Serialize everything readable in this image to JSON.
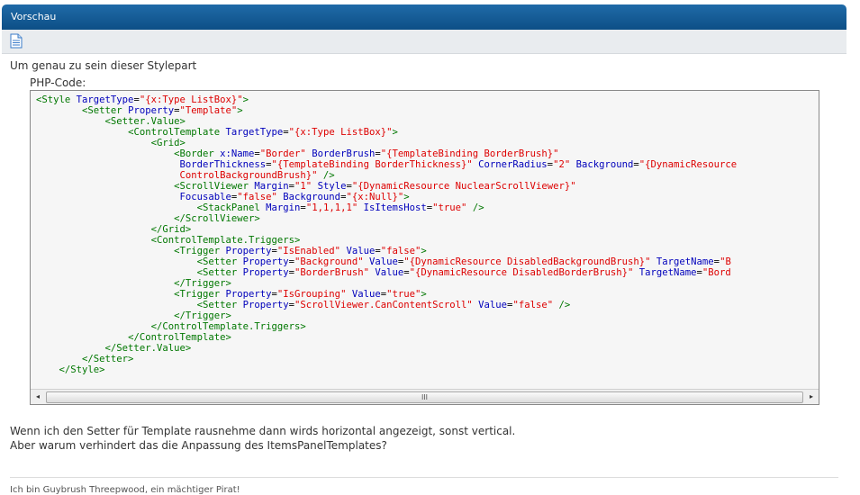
{
  "header": {
    "title": "Vorschau"
  },
  "toolbar": {
    "icon": "document-icon"
  },
  "post": {
    "intro": "Um genau zu sein dieser Stylepart",
    "code_label": "PHP-Code:",
    "code_lines": [
      [
        [
          "t",
          "<Style "
        ],
        [
          "a",
          "TargetType"
        ],
        [
          "p",
          "="
        ],
        [
          "s",
          "\"{x:Type ListBox}\""
        ],
        [
          "t",
          ">"
        ]
      ],
      [
        [
          "p",
          "        "
        ],
        [
          "t",
          "<Setter "
        ],
        [
          "a",
          "Property"
        ],
        [
          "p",
          "="
        ],
        [
          "s",
          "\"Template\""
        ],
        [
          "t",
          ">"
        ]
      ],
      [
        [
          "p",
          "            "
        ],
        [
          "t",
          "<Setter.Value>"
        ]
      ],
      [
        [
          "p",
          "                "
        ],
        [
          "t",
          "<ControlTemplate "
        ],
        [
          "a",
          "TargetType"
        ],
        [
          "p",
          "="
        ],
        [
          "s",
          "\"{x:Type ListBox}\""
        ],
        [
          "t",
          ">"
        ]
      ],
      [
        [
          "p",
          "                    "
        ],
        [
          "t",
          "<Grid>"
        ]
      ],
      [
        [
          "p",
          "                        "
        ],
        [
          "t",
          "<Border "
        ],
        [
          "a",
          "x:Name"
        ],
        [
          "p",
          "="
        ],
        [
          "s",
          "\"Border\" "
        ],
        [
          "a",
          "BorderBrush"
        ],
        [
          "p",
          "="
        ],
        [
          "s",
          "\"{TemplateBinding BorderBrush}\""
        ]
      ],
      [
        [
          "p",
          "                         "
        ],
        [
          "a",
          "BorderThickness"
        ],
        [
          "p",
          "="
        ],
        [
          "s",
          "\"{TemplateBinding BorderThickness}\" "
        ],
        [
          "a",
          "CornerRadius"
        ],
        [
          "p",
          "="
        ],
        [
          "s",
          "\"2\" "
        ],
        [
          "a",
          "Background"
        ],
        [
          "p",
          "="
        ],
        [
          "s",
          "\"{DynamicResource"
        ]
      ],
      [
        [
          "p",
          "                         "
        ],
        [
          "s",
          "ControlBackgroundBrush}\" "
        ],
        [
          "t",
          "/>"
        ]
      ],
      [
        [
          "p",
          "                        "
        ],
        [
          "t",
          "<ScrollViewer "
        ],
        [
          "a",
          "Margin"
        ],
        [
          "p",
          "="
        ],
        [
          "s",
          "\"1\" "
        ],
        [
          "a",
          "Style"
        ],
        [
          "p",
          "="
        ],
        [
          "s",
          "\"{DynamicResource NuclearScrollViewer}\""
        ]
      ],
      [
        [
          "p",
          "                         "
        ],
        [
          "a",
          "Focusable"
        ],
        [
          "p",
          "="
        ],
        [
          "s",
          "\"false\" "
        ],
        [
          "a",
          "Background"
        ],
        [
          "p",
          "="
        ],
        [
          "s",
          "\"{x:Null}\""
        ],
        [
          "t",
          ">"
        ]
      ],
      [
        [
          "p",
          "                            "
        ],
        [
          "t",
          "<StackPanel "
        ],
        [
          "a",
          "Margin"
        ],
        [
          "p",
          "="
        ],
        [
          "s",
          "\"1,1,1,1\" "
        ],
        [
          "a",
          "IsItemsHost"
        ],
        [
          "p",
          "="
        ],
        [
          "s",
          "\"true\" "
        ],
        [
          "t",
          "/>"
        ]
      ],
      [
        [
          "p",
          "                        "
        ],
        [
          "t",
          "</ScrollViewer>"
        ]
      ],
      [
        [
          "p",
          "                    "
        ],
        [
          "t",
          "</Grid>"
        ]
      ],
      [
        [
          "p",
          "                    "
        ],
        [
          "t",
          "<ControlTemplate.Triggers>"
        ]
      ],
      [
        [
          "p",
          "                        "
        ],
        [
          "t",
          "<Trigger "
        ],
        [
          "a",
          "Property"
        ],
        [
          "p",
          "="
        ],
        [
          "s",
          "\"IsEnabled\" "
        ],
        [
          "a",
          "Value"
        ],
        [
          "p",
          "="
        ],
        [
          "s",
          "\"false\""
        ],
        [
          "t",
          ">"
        ]
      ],
      [
        [
          "p",
          "                            "
        ],
        [
          "t",
          "<Setter "
        ],
        [
          "a",
          "Property"
        ],
        [
          "p",
          "="
        ],
        [
          "s",
          "\"Background\" "
        ],
        [
          "a",
          "Value"
        ],
        [
          "p",
          "="
        ],
        [
          "s",
          "\"{DynamicResource DisabledBackgroundBrush}\" "
        ],
        [
          "a",
          "TargetName"
        ],
        [
          "p",
          "="
        ],
        [
          "s",
          "\"B"
        ]
      ],
      [
        [
          "p",
          "                            "
        ],
        [
          "t",
          "<Setter "
        ],
        [
          "a",
          "Property"
        ],
        [
          "p",
          "="
        ],
        [
          "s",
          "\"BorderBrush\" "
        ],
        [
          "a",
          "Value"
        ],
        [
          "p",
          "="
        ],
        [
          "s",
          "\"{DynamicResource DisabledBorderBrush}\" "
        ],
        [
          "a",
          "TargetName"
        ],
        [
          "p",
          "="
        ],
        [
          "s",
          "\"Bord"
        ]
      ],
      [
        [
          "p",
          "                        "
        ],
        [
          "t",
          "</Trigger>"
        ]
      ],
      [
        [
          "p",
          "                        "
        ],
        [
          "t",
          "<Trigger "
        ],
        [
          "a",
          "Property"
        ],
        [
          "p",
          "="
        ],
        [
          "s",
          "\"IsGrouping\" "
        ],
        [
          "a",
          "Value"
        ],
        [
          "p",
          "="
        ],
        [
          "s",
          "\"true\""
        ],
        [
          "t",
          ">"
        ]
      ],
      [
        [
          "p",
          "                            "
        ],
        [
          "t",
          "<Setter "
        ],
        [
          "a",
          "Property"
        ],
        [
          "p",
          "="
        ],
        [
          "s",
          "\"ScrollViewer.CanContentScroll\" "
        ],
        [
          "a",
          "Value"
        ],
        [
          "p",
          "="
        ],
        [
          "s",
          "\"false\" "
        ],
        [
          "t",
          "/>"
        ]
      ],
      [
        [
          "p",
          "                        "
        ],
        [
          "t",
          "</Trigger>"
        ]
      ],
      [
        [
          "p",
          "                    "
        ],
        [
          "t",
          "</ControlTemplate.Triggers>"
        ]
      ],
      [
        [
          "p",
          "                "
        ],
        [
          "t",
          "</ControlTemplate>"
        ]
      ],
      [
        [
          "p",
          "            "
        ],
        [
          "t",
          "</Setter.Value>"
        ]
      ],
      [
        [
          "p",
          "        "
        ],
        [
          "t",
          "</Setter>"
        ]
      ],
      [
        [
          "p",
          "    "
        ],
        [
          "t",
          "</Style>"
        ]
      ]
    ],
    "scroll_left": "◂",
    "scroll_right": "▸",
    "scroll_grip": "III",
    "paragraph1": "Wenn ich den Setter für Template rausnehme dann wirds horizontal angezeigt, sonst vertical.",
    "paragraph2": "Aber warum verhindert das die Anpassung des ItemsPanelTemplates?",
    "signature": "Ich bin Guybrush Threepwood, ein mächtiger Pirat!"
  }
}
